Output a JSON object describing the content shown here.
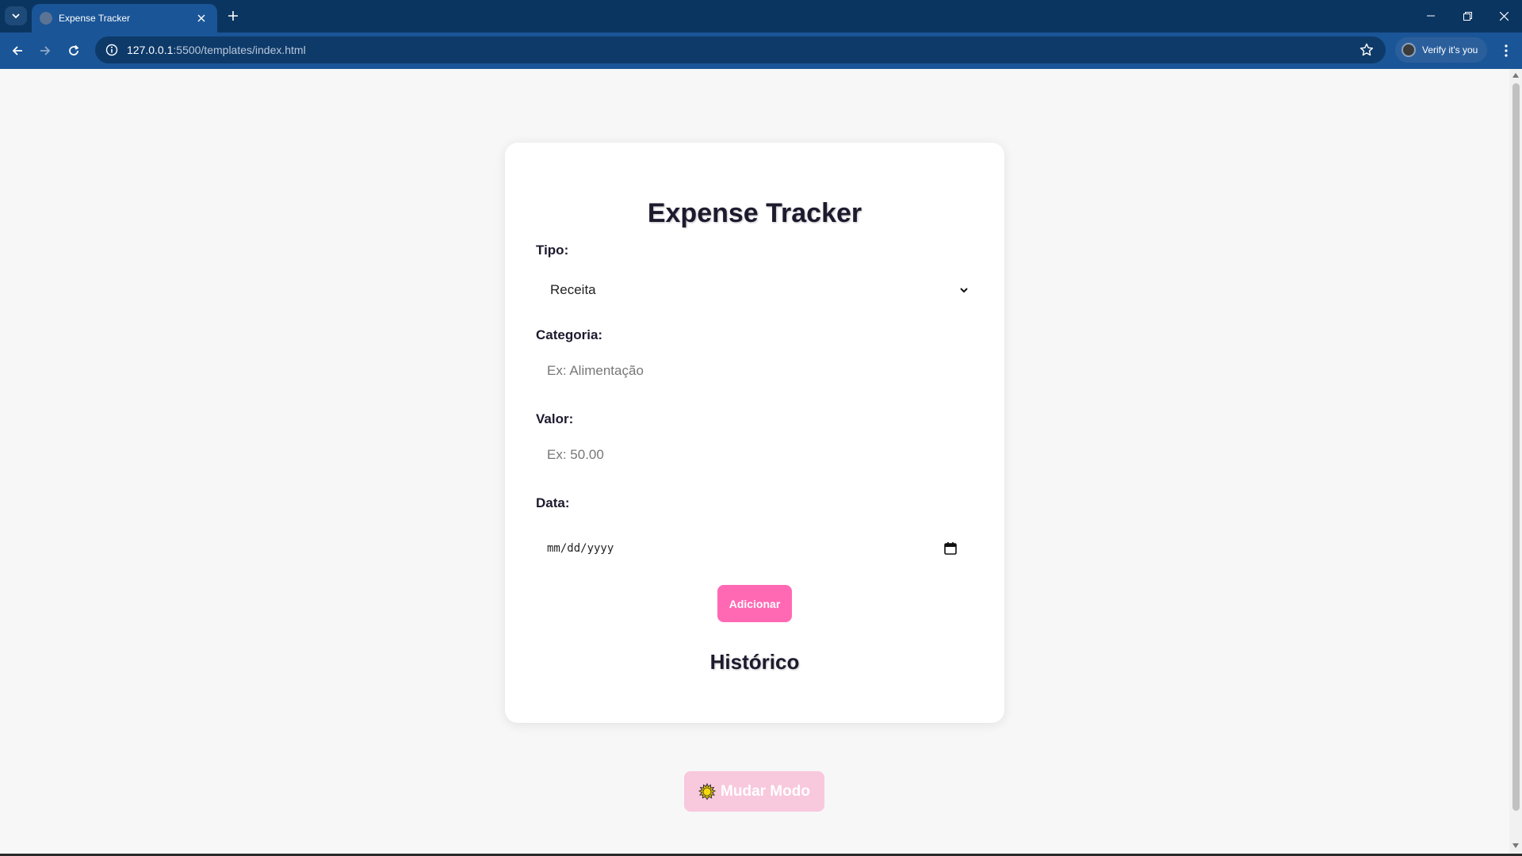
{
  "browser": {
    "tab_title": "Expense Tracker",
    "url_host": "127.0.0.1",
    "url_rest": ":5500/templates/index.html",
    "verify_label": "Verify it's you"
  },
  "page": {
    "title": "Expense Tracker",
    "fields": {
      "tipo_label": "Tipo:",
      "tipo_value": "Receita",
      "categoria_label": "Categoria:",
      "categoria_placeholder": "Ex: Alimentação",
      "valor_label": "Valor:",
      "valor_placeholder": "Ex: 50.00",
      "data_label": "Data:",
      "data_placeholder": "mm/dd/yyyy"
    },
    "add_button": "Adicionar",
    "history_title": "Histórico",
    "mode_button": "Mudar Modo"
  },
  "colors": {
    "browser_frame": "#0b3561",
    "toolbar": "#1a5597",
    "accent_pink": "#ff69b4",
    "mode_button_bg": "#f8c8dd"
  },
  "icons": [
    "tab-list-icon",
    "globe-icon",
    "close-icon",
    "plus-icon",
    "minimize-icon",
    "restore-icon",
    "back-icon",
    "forward-icon",
    "reload-icon",
    "info-icon",
    "star-icon",
    "kebab-icon",
    "chevron-down-icon",
    "calendar-icon",
    "sun-icon"
  ]
}
